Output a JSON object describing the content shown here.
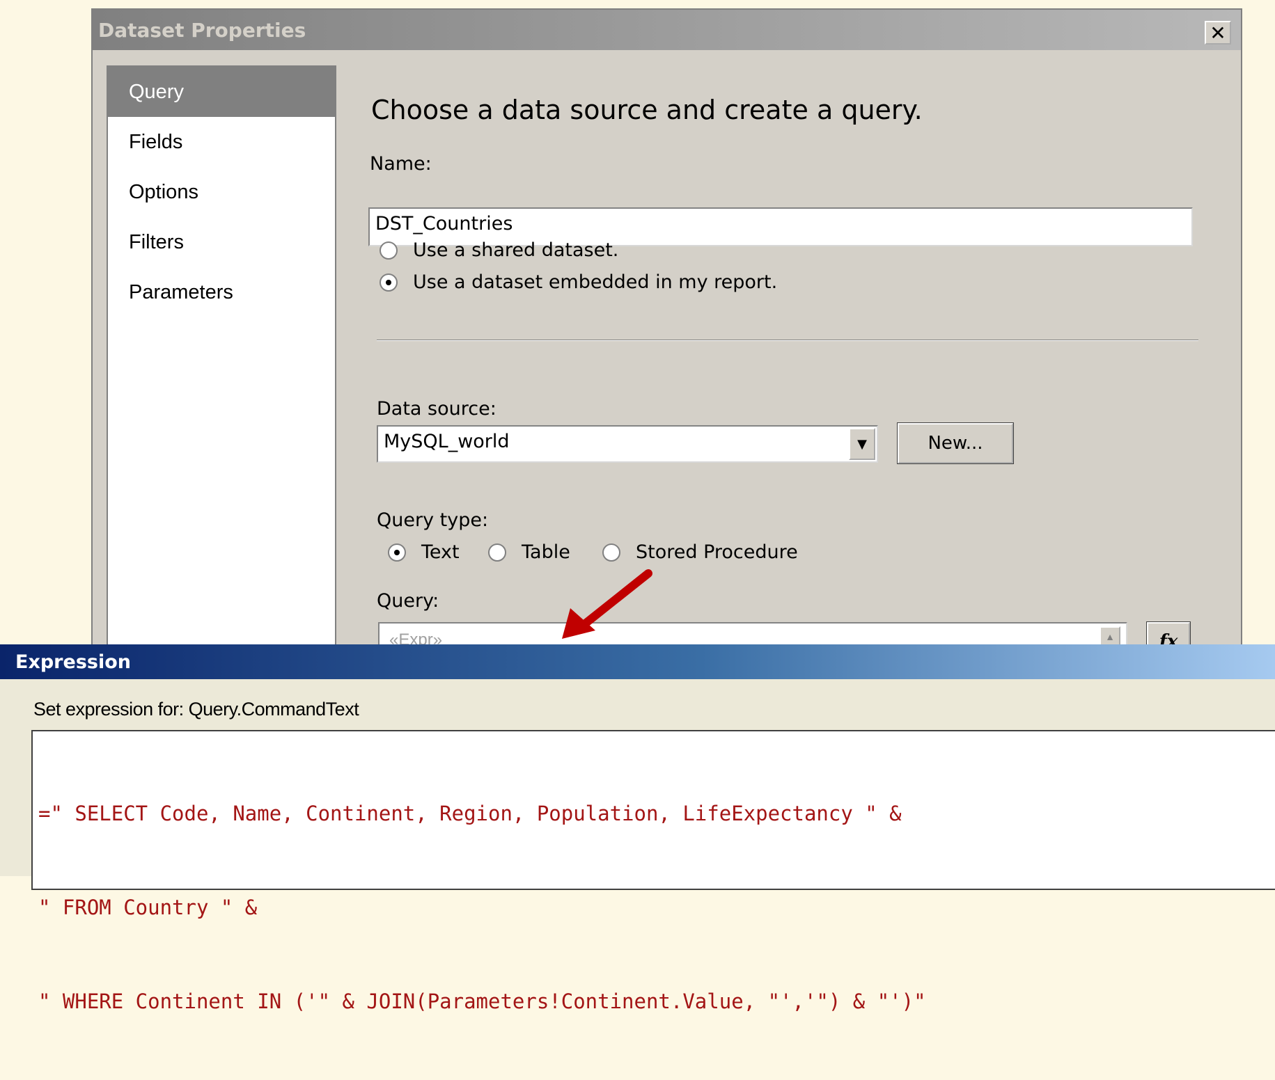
{
  "dialog": {
    "title": "Dataset Properties",
    "close_label": "✕"
  },
  "nav": {
    "items": [
      {
        "label": "Query",
        "selected": true
      },
      {
        "label": "Fields"
      },
      {
        "label": "Options"
      },
      {
        "label": "Filters"
      },
      {
        "label": "Parameters"
      }
    ]
  },
  "main": {
    "heading": "Choose a data source and create a query.",
    "name_label": "Name:",
    "name_value": "DST_Countries",
    "dataset_options": [
      {
        "label": "Use a shared dataset.",
        "checked": false
      },
      {
        "label": "Use a dataset embedded in my report.",
        "checked": true
      }
    ],
    "data_source_label": "Data source:",
    "data_source_value": "MySQL_world",
    "new_button": "New...",
    "query_type_label": "Query type:",
    "query_types": [
      {
        "label": "Text",
        "checked": true
      },
      {
        "label": "Table",
        "checked": false
      },
      {
        "label": "Stored Procedure",
        "checked": false
      }
    ],
    "query_label": "Query:",
    "query_value": "«Expr»",
    "fx_button": "fx"
  },
  "expression": {
    "title": "Expression",
    "set_label": "Set expression for: Query.CommandText",
    "lines": [
      "=\" SELECT Code, Name, Continent, Region, Population, LifeExpectancy \" &",
      "\" FROM Country \" &",
      "\" WHERE Continent IN ('\" & JOIN(Parameters!Continent.Value, \"','\") & \"')\""
    ]
  },
  "colors": {
    "dialog_bg": "#d4d0c8",
    "expr_title_start": "#0a246a",
    "string_color": "#a31515",
    "arrow": "#c00000"
  }
}
